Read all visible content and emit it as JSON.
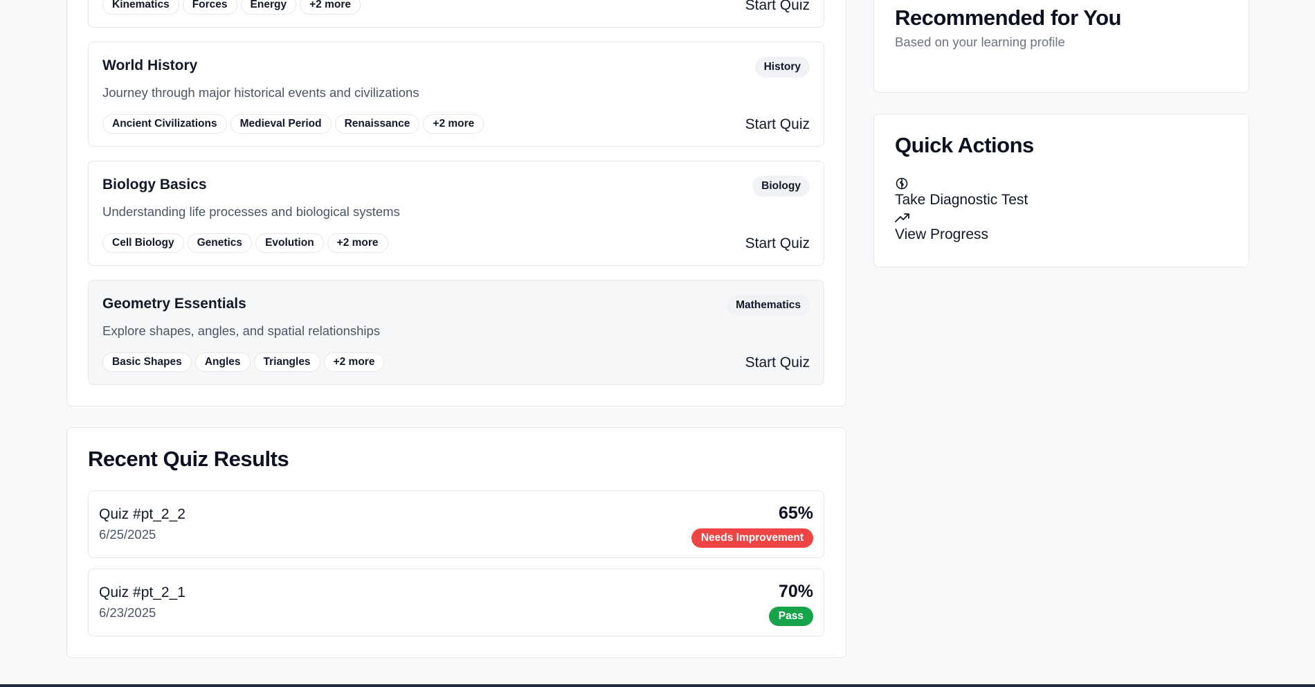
{
  "quizzes": [
    {
      "title": "",
      "description": "",
      "category": "",
      "topics": [
        "Kinematics",
        "Forces",
        "Energy",
        "+2 more"
      ],
      "action": "Start Quiz"
    },
    {
      "title": "World History",
      "description": "Journey through major historical events and civilizations",
      "category": "History",
      "topics": [
        "Ancient Civilizations",
        "Medieval Period",
        "Renaissance",
        "+2 more"
      ],
      "action": "Start Quiz"
    },
    {
      "title": "Biology Basics",
      "description": "Understanding life processes and biological systems",
      "category": "Biology",
      "topics": [
        "Cell Biology",
        "Genetics",
        "Evolution",
        "+2 more"
      ],
      "action": "Start Quiz"
    },
    {
      "title": "Geometry Essentials",
      "description": "Explore shapes, angles, and spatial relationships",
      "category": "Mathematics",
      "topics": [
        "Basic Shapes",
        "Angles",
        "Triangles",
        "+2 more"
      ],
      "action": "Start Quiz"
    }
  ],
  "recent_results": {
    "title": "Recent Quiz Results",
    "items": [
      {
        "name": "Quiz #pt_2_2",
        "date": "6/25/2025",
        "score": "65%",
        "status": "Needs Improvement",
        "status_color": "#ef4444"
      },
      {
        "name": "Quiz #pt_2_1",
        "date": "6/23/2025",
        "score": "70%",
        "status": "Pass",
        "status_color": "#16a34a"
      }
    ]
  },
  "recommended": {
    "title": "Recommended for You",
    "subtitle": "Based on your learning profile"
  },
  "quick_actions": {
    "title": "Quick Actions",
    "items": [
      {
        "icon": "brain-icon",
        "label": "Take Diagnostic Test"
      },
      {
        "icon": "trending-up-icon",
        "label": "View Progress"
      }
    ]
  }
}
